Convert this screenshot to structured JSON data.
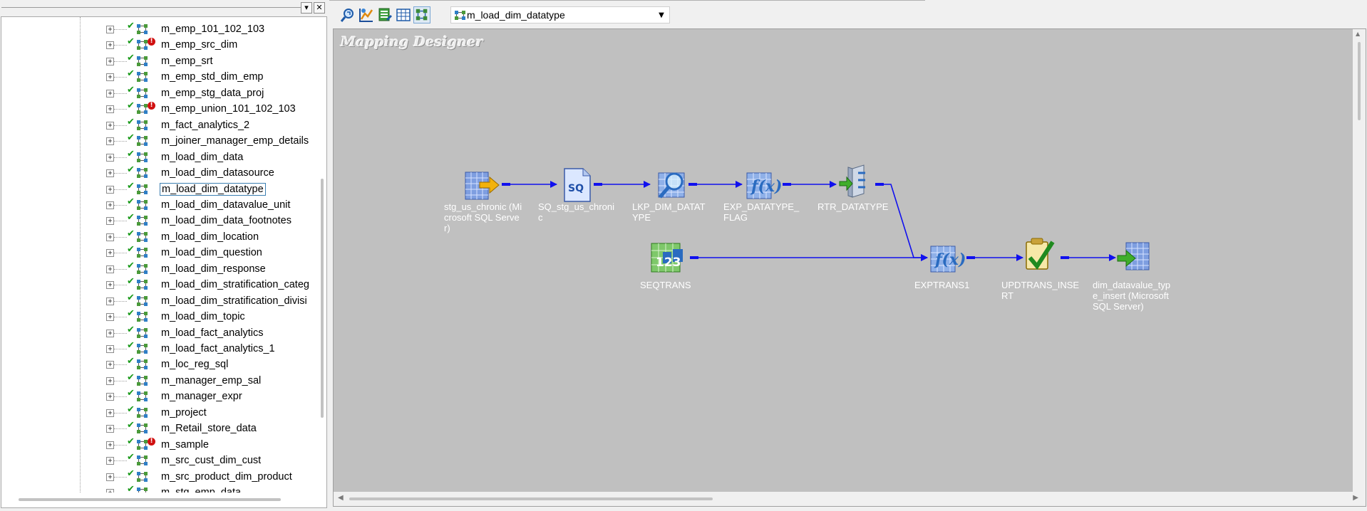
{
  "navigator": {
    "header_buttons": [
      "▾",
      "✕"
    ],
    "items": [
      {
        "label": "m_emp_101_102_103",
        "error": false,
        "selected": false
      },
      {
        "label": "m_emp_src_dim",
        "error": true,
        "selected": false
      },
      {
        "label": "m_emp_srt",
        "error": false,
        "selected": false
      },
      {
        "label": "m_emp_std_dim_emp",
        "error": false,
        "selected": false
      },
      {
        "label": "m_emp_stg_data_proj",
        "error": false,
        "selected": false
      },
      {
        "label": "m_emp_union_101_102_103",
        "error": true,
        "selected": false
      },
      {
        "label": "m_fact_analytics_2",
        "error": false,
        "selected": false
      },
      {
        "label": "m_joiner_manager_emp_details",
        "error": false,
        "selected": false
      },
      {
        "label": "m_load_dim_data",
        "error": false,
        "selected": false
      },
      {
        "label": "m_load_dim_datasource",
        "error": false,
        "selected": false
      },
      {
        "label": "m_load_dim_datatype",
        "error": false,
        "selected": true
      },
      {
        "label": "m_load_dim_datavalue_unit",
        "error": false,
        "selected": false
      },
      {
        "label": "m_load_dim_data_footnotes",
        "error": false,
        "selected": false
      },
      {
        "label": "m_load_dim_location",
        "error": false,
        "selected": false
      },
      {
        "label": "m_load_dim_question",
        "error": false,
        "selected": false
      },
      {
        "label": "m_load_dim_response",
        "error": false,
        "selected": false
      },
      {
        "label": "m_load_dim_stratification_categ",
        "error": false,
        "selected": false
      },
      {
        "label": "m_load_dim_stratification_divisi",
        "error": false,
        "selected": false
      },
      {
        "label": "m_load_dim_topic",
        "error": false,
        "selected": false
      },
      {
        "label": "m_load_fact_analytics",
        "error": false,
        "selected": false
      },
      {
        "label": "m_load_fact_analytics_1",
        "error": false,
        "selected": false
      },
      {
        "label": "m_loc_reg_sql",
        "error": false,
        "selected": false
      },
      {
        "label": "m_manager_emp_sal",
        "error": false,
        "selected": false
      },
      {
        "label": "m_manager_expr",
        "error": false,
        "selected": false
      },
      {
        "label": "m_project",
        "error": false,
        "selected": false
      },
      {
        "label": "m_Retail_store_data",
        "error": false,
        "selected": false
      },
      {
        "label": "m_sample",
        "error": true,
        "selected": false
      },
      {
        "label": "m_src_cust_dim_cust",
        "error": false,
        "selected": false
      },
      {
        "label": "m_src_product_dim_product",
        "error": false,
        "selected": false
      },
      {
        "label": "m_stg_emp_data",
        "error": false,
        "selected": false
      }
    ]
  },
  "toolbar": {
    "buttons": [
      "zoom-icon",
      "source-analyzer-icon",
      "target-designer-icon",
      "transformation-developer-icon",
      "mapping-designer-icon"
    ],
    "active_button": "mapping-designer-icon",
    "mapping_select": {
      "value": "m_load_dim_datatype",
      "arrow": "▼"
    }
  },
  "canvas": {
    "title": "Mapping Designer",
    "background": "#c0c0c0",
    "link_color": "#1010ee",
    "nodes": {
      "source": {
        "label": "stg_us_chronic (Microsoft SQL Server)",
        "icon": "source-definition-icon"
      },
      "source_qualifier": {
        "label": "SQ_stg_us_chronic",
        "icon": "source-qualifier-icon",
        "glyph": "SQ"
      },
      "lookup": {
        "label": "LKP_DIM_DATATYPE",
        "icon": "lookup-icon"
      },
      "expression_flag": {
        "label": "EXP_DATATYPE_FLAG",
        "icon": "expression-icon",
        "glyph": "f(x)"
      },
      "router": {
        "label": "RTR_DATATYPE",
        "icon": "router-icon"
      },
      "sequence": {
        "label": "SEQTRANS",
        "icon": "sequence-generator-icon",
        "glyph": "123"
      },
      "expression_1": {
        "label": "EXPTRANS1",
        "icon": "expression-icon",
        "glyph": "f(x)"
      },
      "update_strategy": {
        "label": "UPDTRANS_INSERT",
        "icon": "update-strategy-icon"
      },
      "target": {
        "label": "dim_datavalue_type_insert (Microsoft SQL Server)",
        "icon": "target-definition-icon"
      }
    }
  }
}
